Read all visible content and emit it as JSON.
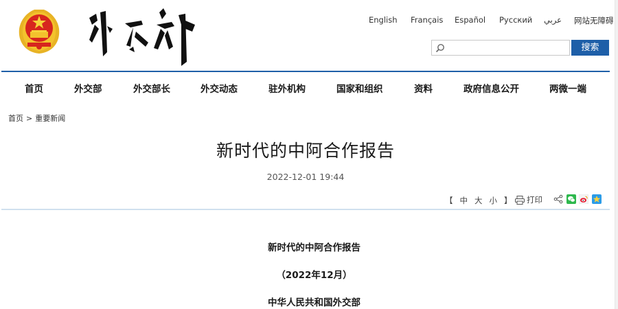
{
  "header": {
    "emblem_name": "national-emblem",
    "logo_text": "外交部"
  },
  "languages": [
    {
      "label": "English"
    },
    {
      "label": "Français"
    },
    {
      "label": "Español"
    },
    {
      "label": "Русский"
    },
    {
      "label": "عربي"
    },
    {
      "label": "网站无障碍"
    }
  ],
  "search": {
    "placeholder": "",
    "value": "",
    "button_label": "搜索"
  },
  "nav": {
    "items": [
      {
        "label": "首页"
      },
      {
        "label": "外交部"
      },
      {
        "label": "外交部长"
      },
      {
        "label": "外交动态"
      },
      {
        "label": "驻外机构"
      },
      {
        "label": "国家和组织"
      },
      {
        "label": "资料"
      },
      {
        "label": "政府信息公开"
      },
      {
        "label": "两微一端"
      }
    ]
  },
  "breadcrumb": {
    "home": "首页",
    "separator": ">",
    "current": "重要新闻"
  },
  "article": {
    "title": "新时代的中阿合作报告",
    "date": "2022-12-01 19:44",
    "body": {
      "line1": "新时代的中阿合作报告",
      "line2": "（2022年12月）",
      "line3": "中华人民共和国外交部"
    }
  },
  "toolbar": {
    "bracket_open": "【",
    "size_small": "中",
    "size_large": "大",
    "size_xs": "小",
    "bracket_close": "】",
    "print_label": "打印",
    "share_icons": [
      "share-icon",
      "wechat-icon",
      "weibo-icon",
      "qzone-icon"
    ]
  },
  "colors": {
    "accent": "#1e5fa8",
    "divider": "#cfe0ef",
    "emblem_red": "#d7261e",
    "emblem_gold": "#f3c22d"
  }
}
